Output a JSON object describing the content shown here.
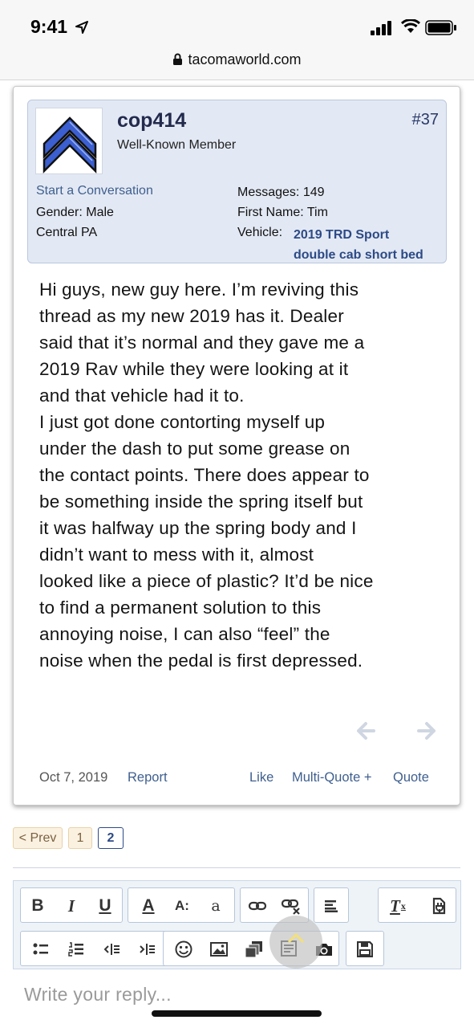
{
  "status_bar": {
    "time": "9:41"
  },
  "browser": {
    "url": "tacomaworld.com"
  },
  "post": {
    "username": "cop414",
    "user_title": "Well-Known Member",
    "post_number": "#37",
    "start_conversation": "Start a Conversation",
    "gender": "Gender: Male",
    "region": "Central PA",
    "messages": "Messages: 149",
    "first_name": "First Name: Tim",
    "vehicle_label": "Vehicle:",
    "vehicle_line1": "2019 TRD Sport",
    "vehicle_line2": "double cab short bed",
    "body_lines": [
      "Hi guys, new guy here. I’m reviving this",
      "thread as my new 2019 has it. Dealer",
      "said that it’s normal and they gave me a",
      "2019 Rav while they were looking at it",
      "and that vehicle had it to.",
      "I just got done contorting myself up",
      "under the dash to put some grease on",
      "the contact points. There does appear to",
      "be something inside the spring itself but",
      "it was halfway up the spring body and I",
      "didn’t want to mess with it, almost",
      "looked like a piece of plastic? It’d be nice",
      "to find a permanent solution to this",
      "annoying noise, I can also “feel” the",
      "noise when the pedal is first depressed."
    ],
    "date": "Oct 7, 2019",
    "report": "Report",
    "like": "Like",
    "multi_quote": "Multi-Quote +",
    "quote": "Quote"
  },
  "pagination": {
    "prev": "< Prev",
    "page1": "1",
    "page2": "2",
    "current_page": 2
  },
  "editor": {
    "bold": "B",
    "italic": "I",
    "underline": "U",
    "font_color": "A",
    "font_size": "A:",
    "font_family": "a",
    "remove_format": "T",
    "reply_placeholder": "Write your reply..."
  },
  "colors": {
    "username": "#222a4d",
    "link": "#3f5f8f",
    "userbox_bg": "#e3e9f4",
    "vehicle": "#2d4a86"
  }
}
